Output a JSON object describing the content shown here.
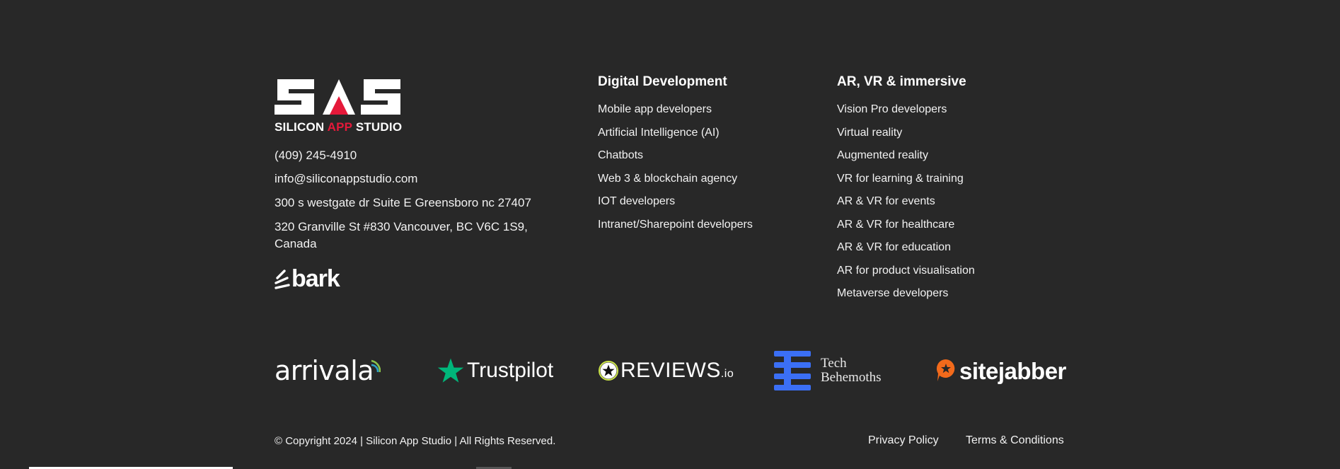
{
  "brand": {
    "logo_word": "SAS",
    "logo_sub_1": "SILICON ",
    "logo_sub_accent": "APP",
    "logo_sub_2": " STUDIO",
    "accent_color": "#e5193a"
  },
  "contact": {
    "phone": "(409) 245-4910",
    "email": "info@siliconappstudio.com",
    "address_us": "300 s westgate dr Suite E Greensboro nc 27407",
    "address_ca": "320 Granville St #830 Vancouver, BC V6C 1S9, Canada"
  },
  "bark": {
    "label": "bark",
    "icon": "bark-wave-icon"
  },
  "columns": {
    "digital": {
      "title": "Digital Development",
      "items": [
        "Mobile app developers",
        "Artificial Intelligence (AI)",
        "Chatbots",
        "Web 3 & blockchain agency",
        "IOT developers",
        "Intranet/Sharepoint developers"
      ]
    },
    "immersive": {
      "title": "AR, VR & immersive",
      "items": [
        "Vision Pro developers",
        "Virtual reality",
        "Augmented reality",
        "VR for learning & training",
        "AR & VR for events",
        "AR & VR for healthcare",
        "AR & VR for education",
        "AR for product visualisation",
        "Metaverse developers"
      ]
    }
  },
  "reviews": {
    "arrivala": "arrivala",
    "trustpilot": "Trustpilot",
    "reviewsio_main": "REVIEWS",
    "reviewsio_suffix": ".io",
    "techbehemoths_1": "Tech",
    "techbehemoths_2": "Behemoths",
    "sitejabber": "sitejabber",
    "colors": {
      "trustpilot_star": "#00b67a",
      "techbehemoths_blue": "#3b6ff5",
      "sitejabber_orange": "#f26a1b",
      "arrivala_green": "#8bc34a",
      "arrivala_blue": "#2fa4c7"
    }
  },
  "footer": {
    "copyright": "© Copyright 2024 | Silicon App Studio | All Rights Reserved.",
    "privacy": "Privacy Policy",
    "terms": "Terms & Conditions"
  }
}
